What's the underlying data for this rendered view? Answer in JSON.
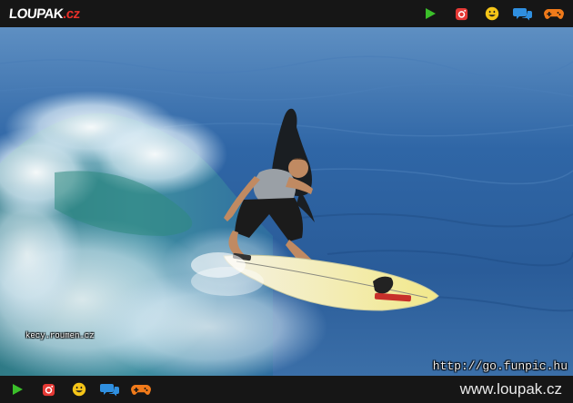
{
  "header": {
    "logo_main": "LOUPAK",
    "logo_tld": ".cz",
    "icons": [
      "play-icon",
      "instagram-icon",
      "smiley-icon",
      "chat-icon",
      "gamepad-icon"
    ]
  },
  "photo": {
    "watermark_left": "kecy.roumen.cz",
    "watermark_right": "http://go.funpic.hu"
  },
  "footer": {
    "icons": [
      "play-icon",
      "instagram-icon",
      "smiley-icon",
      "chat-icon",
      "gamepad-icon"
    ],
    "site_url": "www.loupak.cz"
  },
  "colors": {
    "bar_bg": "#161616",
    "brand_red": "#e8302a",
    "play_green": "#3bbf2a",
    "instagram_red": "#e53935",
    "smiley_yellow": "#f5c518",
    "chat_blue": "#2f8fe0",
    "gamepad_orange": "#f07a1a",
    "ocean_blue": "#2f66a6"
  }
}
